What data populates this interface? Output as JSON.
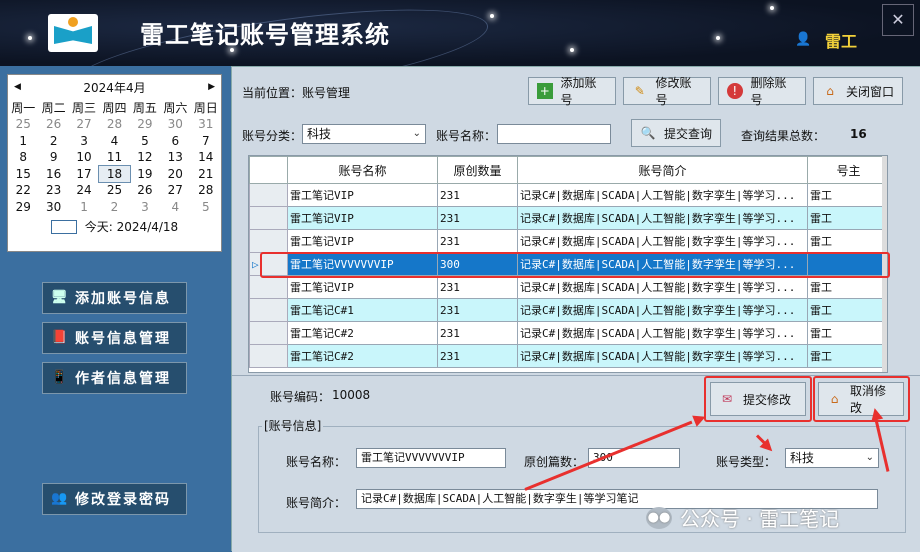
{
  "window": {
    "title": "雷工笔记账号管理系统",
    "user": "雷工",
    "close": "✕"
  },
  "calendar": {
    "month": "2024年4月",
    "prev": "◀",
    "next": "▶",
    "weekdays": [
      "周一",
      "周二",
      "周三",
      "周四",
      "周五",
      "周六",
      "周日"
    ],
    "weeks": [
      [
        "25",
        "26",
        "27",
        "28",
        "29",
        "30",
        "31"
      ],
      [
        "1",
        "2",
        "3",
        "4",
        "5",
        "6",
        "7"
      ],
      [
        "8",
        "9",
        "10",
        "11",
        "12",
        "13",
        "14"
      ],
      [
        "15",
        "16",
        "17",
        "18",
        "19",
        "20",
        "21"
      ],
      [
        "22",
        "23",
        "24",
        "25",
        "26",
        "27",
        "28"
      ],
      [
        "29",
        "30",
        "1",
        "2",
        "3",
        "4",
        "5"
      ]
    ],
    "today": "今天: 2024/4/18"
  },
  "sidebar": {
    "items": [
      {
        "label": "添加账号信息",
        "icon": "monitor-icon"
      },
      {
        "label": "账号信息管理",
        "icon": "book-icon"
      },
      {
        "label": "作者信息管理",
        "icon": "phone-icon"
      },
      {
        "label": "修改登录密码",
        "icon": "user-lock-icon"
      }
    ]
  },
  "breadcrumb": "当前位置：账号管理",
  "toolbar": {
    "add": "添加账号",
    "edit": "修改账号",
    "delete": "删除账号",
    "close": "关闭窗口"
  },
  "search": {
    "category_label": "账号分类：",
    "category_value": "科技",
    "name_label": "账号名称：",
    "name_value": "",
    "query_button": "提交查询",
    "total_label": "查询结果总数：",
    "total_value": "16"
  },
  "grid": {
    "columns": [
      "账号名称",
      "原创数量",
      "账号简介",
      "号主"
    ],
    "rows": [
      [
        "雷工笔记VIP",
        "231",
        "记录C#|数据库|SCADA|人工智能|数字孪生|等学习...",
        "雷工"
      ],
      [
        "雷工笔记VIP",
        "231",
        "记录C#|数据库|SCADA|人工智能|数字孪生|等学习...",
        "雷工"
      ],
      [
        "雷工笔记VIP",
        "231",
        "记录C#|数据库|SCADA|人工智能|数字孪生|等学习...",
        "雷工"
      ],
      [
        "雷工笔记VVVVVVVIP",
        "300",
        "记录C#|数据库|SCADA|人工智能|数字孪生|等学习...",
        ""
      ],
      [
        "雷工笔记VIP",
        "231",
        "记录C#|数据库|SCADA|人工智能|数字孪生|等学习...",
        "雷工"
      ],
      [
        "雷工笔记C#1",
        "231",
        "记录C#|数据库|SCADA|人工智能|数字孪生|等学习...",
        "雷工"
      ],
      [
        "雷工笔记C#2",
        "231",
        "记录C#|数据库|SCADA|人工智能|数字孪生|等学习...",
        "雷工"
      ],
      [
        "雷工笔记C#2",
        "231",
        "记录C#|数据库|SCADA|人工智能|数字孪生|等学习...",
        "雷工"
      ]
    ],
    "selected_marker": "▷"
  },
  "detail": {
    "code_label": "账号编码：",
    "code_value": "10008",
    "submit": "提交修改",
    "cancel": "取消修改",
    "group_title": "[账号信息]",
    "name_label": "账号名称：",
    "name_value": "雷工笔记VVVVVVVIP",
    "count_label": "原创篇数：",
    "count_value": "300",
    "type_label": "账号类型：",
    "type_value": "科技",
    "intro_label": "账号简介：",
    "intro_value": "记录C#|数据库|SCADA|人工智能|数字孪生|等学习笔记"
  },
  "watermark": "公众号 · 雷工笔记",
  "colors": {
    "accent": "#1577c9",
    "highlight": "#e8302e",
    "row_alt": "#c9f6fb"
  }
}
